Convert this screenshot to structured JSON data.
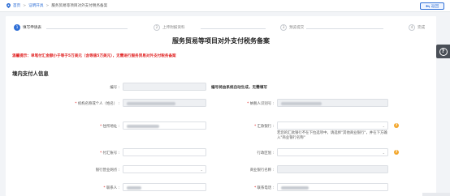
{
  "breadcrumb": {
    "home": "首页",
    "level1": "证明开具",
    "current": "服务贸易等项目对外支付税务备案",
    "sep": ">"
  },
  "back_label": "返回",
  "steps": [
    {
      "num": "1",
      "label": "填写申请表",
      "active": true
    },
    {
      "num": "2",
      "label": "上传附报资料",
      "active": false
    },
    {
      "num": "3",
      "label": "预览提交",
      "active": false
    },
    {
      "num": "4",
      "label": "完成",
      "active": false
    }
  ],
  "title": "服务贸易等项目对外支付税务备案",
  "warning": "温馨提示：单笔付汇金额小于等于5万美元（含等值5万美元），无需进行服务贸易对外支付税务备案",
  "section": "境内支付人信息",
  "form": {
    "bianhao_label": "编号",
    "bianhao_note": "编号将由系统自动生成，无需填写",
    "jigou_label": "机构名称或个人（姓名）",
    "shuiwu_label": "纳税人识别号",
    "address_label": "住所地址",
    "bank_label": "汇款银行",
    "bank_placeholder": "请选择",
    "bank_note": "若您的汇款银行不在下拉选项中，请选择\"其他商业银行\"，并在下方输入\"商业银行名称\"",
    "account_label": "付汇账号",
    "hangbie_label": "行政区划",
    "yinhang_label": "银行营业网点",
    "shangye_label": "商业银行名称",
    "contact_label": "联系人",
    "phone_label": "联系电话"
  },
  "colors": {
    "accent": "#2f6fd6",
    "warning": "#e02020",
    "help": "#f3a62a"
  },
  "icons": {
    "home": "location-pin-icon",
    "back": "return-arrow-icon",
    "help": "question-circle-icon"
  }
}
